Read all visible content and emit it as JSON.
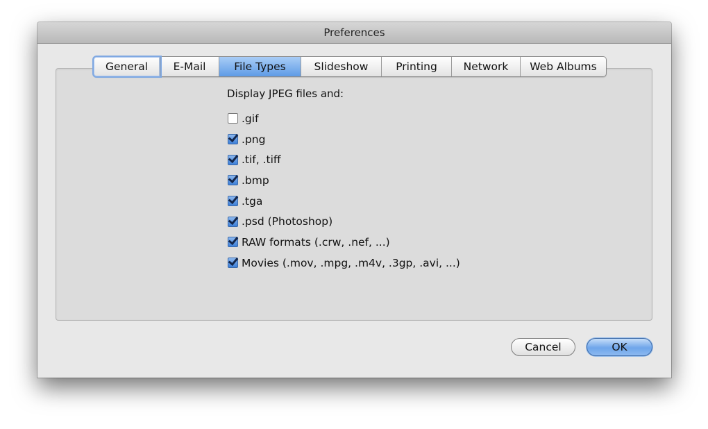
{
  "window": {
    "title": "Preferences"
  },
  "tabs": [
    {
      "label": "General",
      "state": "focused"
    },
    {
      "label": "E-Mail"
    },
    {
      "label": "File Types",
      "state": "selected"
    },
    {
      "label": "Slideshow"
    },
    {
      "label": "Printing"
    },
    {
      "label": "Network"
    },
    {
      "label": "Web Albums"
    }
  ],
  "file_types": {
    "heading": "Display JPEG files and:",
    "options": [
      {
        "label": ".gif",
        "checked": false
      },
      {
        "label": ".png",
        "checked": true
      },
      {
        "label": ".tif, .tiff",
        "checked": true
      },
      {
        "label": ".bmp",
        "checked": true
      },
      {
        "label": ".tga",
        "checked": true
      },
      {
        "label": ".psd (Photoshop)",
        "checked": true
      },
      {
        "label": "RAW formats (.crw, .nef, ...)",
        "checked": true
      },
      {
        "label": "Movies (.mov, .mpg, .m4v, .3gp, .avi, ...)",
        "checked": true
      }
    ]
  },
  "buttons": {
    "cancel": "Cancel",
    "ok": "OK"
  },
  "colors": {
    "selected_tab": "#5e9be6",
    "checkbox_checked": "#3d7fd8",
    "default_button": "#6ea5ea"
  }
}
